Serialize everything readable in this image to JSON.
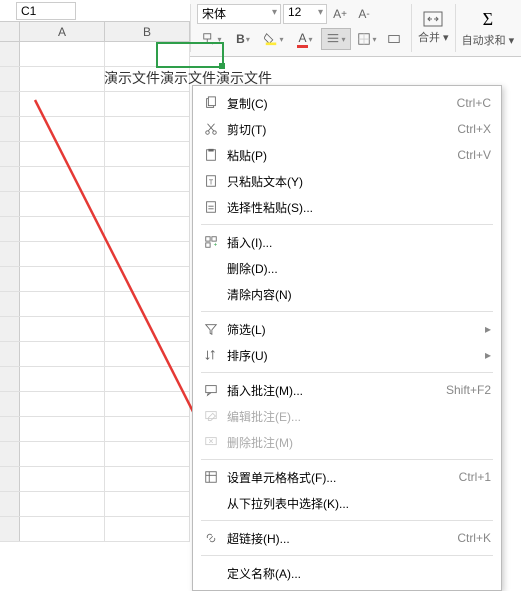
{
  "namebox": {
    "value": "C1"
  },
  "ribbon": {
    "font_name": "宋体",
    "font_size": "12",
    "merge_label": "合并",
    "sum_label": "自动求和"
  },
  "columns": [
    "A",
    "B"
  ],
  "cell_text": "演示文件演示文件演示文件",
  "context_menu": {
    "copy": "复制(C)",
    "cut": "剪切(T)",
    "paste": "粘贴(P)",
    "paste_text": "只粘贴文本(Y)",
    "paste_special": "选择性粘贴(S)...",
    "insert": "插入(I)...",
    "delete": "删除(D)...",
    "clear": "清除内容(N)",
    "filter": "筛选(L)",
    "sort": "排序(U)",
    "insert_comment": "插入批注(M)...",
    "edit_comment": "编辑批注(E)...",
    "delete_comment": "删除批注(M)",
    "format_cells": "设置单元格格式(F)...",
    "pick_list": "从下拉列表中选择(K)...",
    "hyperlink": "超链接(H)...",
    "define_name": "定义名称(A)...",
    "sc_copy": "Ctrl+C",
    "sc_cut": "Ctrl+X",
    "sc_paste": "Ctrl+V",
    "sc_comment": "Shift+F2",
    "sc_format": "Ctrl+1",
    "sc_link": "Ctrl+K"
  }
}
